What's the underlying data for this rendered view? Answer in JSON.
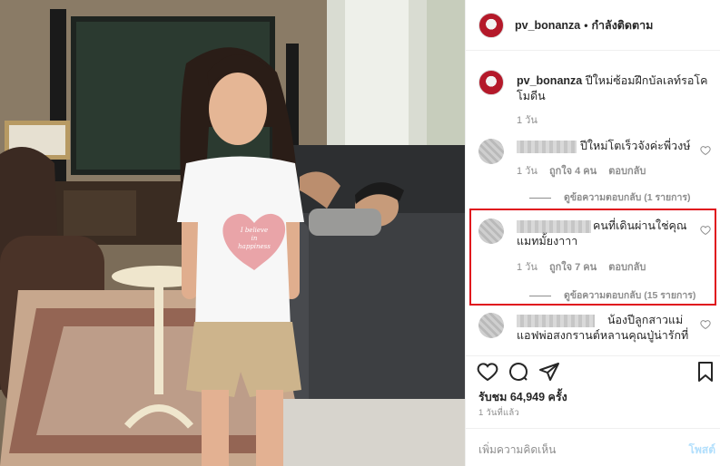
{
  "header": {
    "username": "pv_bonanza",
    "separator": "•",
    "follow_status": "กำลังติดตาม"
  },
  "caption": {
    "username": "pv_bonanza",
    "text": "ปีใหม่ซ้อมฝึกบัลเลท์รอโคโมดีน",
    "time": "1 วัน"
  },
  "comments": [
    {
      "text": "ปีใหม่โตเร็วจังค่ะพี่วงษ์",
      "time": "1 วัน",
      "likes": "ถูกใจ 4 คน",
      "reply_label": "ตอบกลับ",
      "view_replies": "ดูข้อความตอบกลับ (1 รายการ)"
    },
    {
      "text": "คนที่เดินผ่านใช่คุณแมทมั้ยงาาา",
      "time": "1 วัน",
      "likes": "ถูกใจ 7 คน",
      "reply_label": "ตอบกลับ",
      "view_replies": "ดูข้อความตอบกลับ (15 รายการ)"
    },
    {
      "text": "น้องปีลูกสาวแม่แอฟพ่อสงกรานต์หลานคุณปู่น่ารักที่"
    }
  ],
  "stats": {
    "views": "รับชม 64,949 ครั้ง",
    "ago": "1 วันที่แล้ว"
  },
  "add_comment": {
    "placeholder": "เพิ่มความคิดเห็น",
    "post_label": "โพสต์"
  },
  "shirt_text": {
    "line1": "I believe",
    "line2": "in",
    "line3": "happiness"
  },
  "icons": {
    "like": "heart-icon",
    "comment": "comment-icon",
    "share": "share-icon",
    "save": "bookmark-icon",
    "comment_like": "heart-outline-icon"
  },
  "colors": {
    "highlight_border": "#e0111d",
    "post_button": "#b2dffc",
    "muted_text": "#8e8e8e"
  }
}
